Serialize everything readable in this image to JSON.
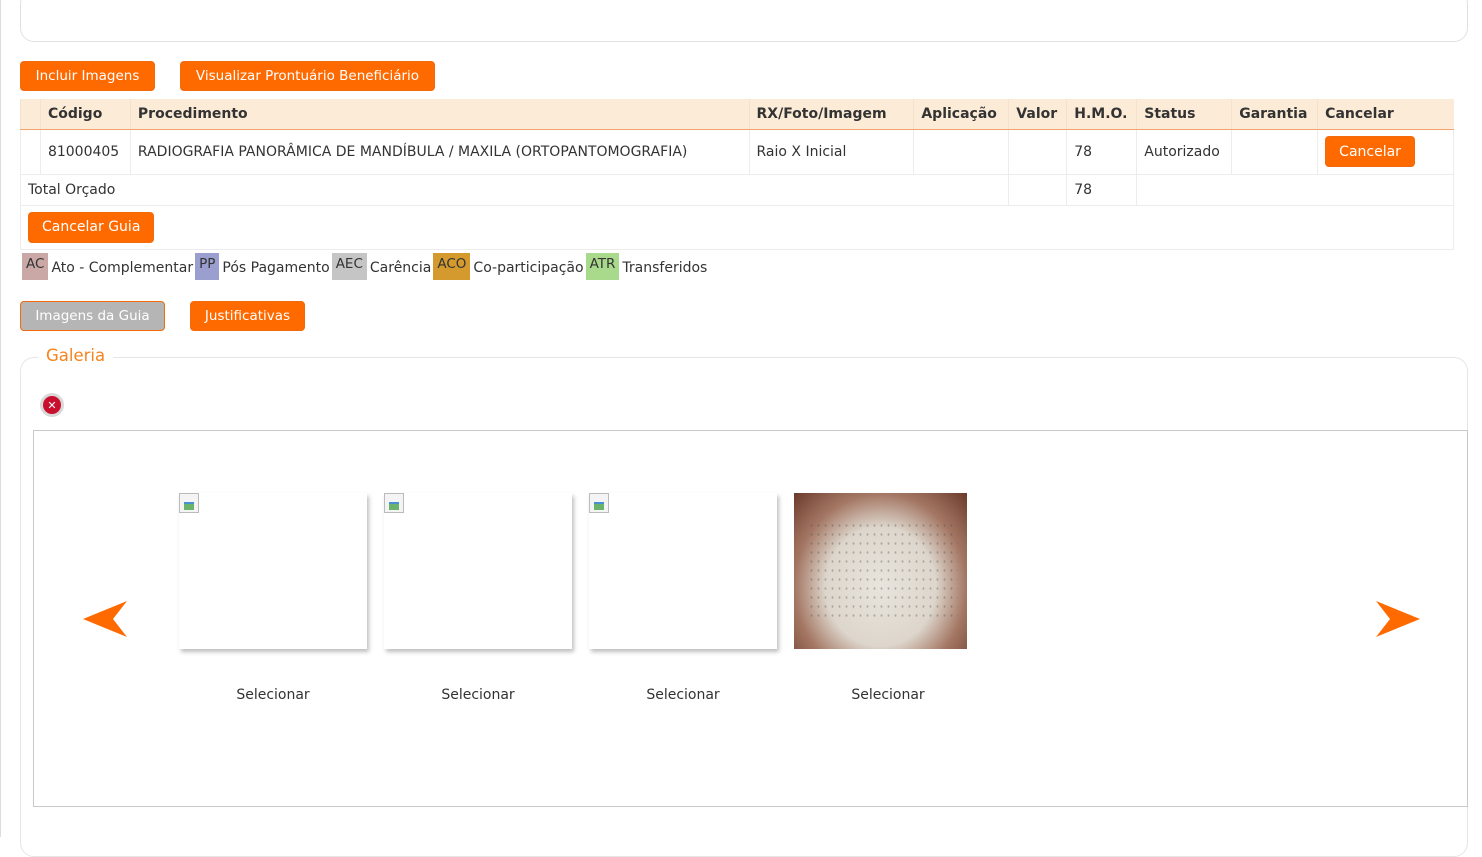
{
  "toolbar": {
    "incluir_imagens": "Incluir Imagens",
    "visualizar_prontuario": "Visualizar Prontuário Beneficiário"
  },
  "table": {
    "headers": [
      "Código",
      "Procedimento",
      "RX/Foto/Imagem",
      "Aplicação",
      "Valor",
      "H.M.O.",
      "Status",
      "Garantia",
      "Cancelar"
    ],
    "rows": [
      {
        "codigo": "81000405",
        "procedimento": "RADIOGRAFIA PANORÂMICA DE MANDÍBULA / MAXILA (ORTOPANTOMOGRAFIA)",
        "rx": "Raio X Inicial",
        "aplicacao": "",
        "valor": "",
        "hmo": "78",
        "status": "Autorizado",
        "garantia": "",
        "cancel_label": "Cancelar"
      }
    ],
    "total_label": "Total Orçado",
    "total_hmo": "78",
    "cancel_guia_label": "Cancelar Guia"
  },
  "legend": [
    {
      "code": "AC",
      "label": "Ato - Complementar",
      "color": "#c9a8a6"
    },
    {
      "code": "PP",
      "label": "Pós Pagamento",
      "color": "#9b9fd0"
    },
    {
      "code": "AEC",
      "label": "Carência",
      "color": "#c5c5c5"
    },
    {
      "code": "ACO",
      "label": "Co-participação",
      "color": "#d49a2e"
    },
    {
      "code": "ATR",
      "label": "Transferidos",
      "color": "#a9d98b"
    }
  ],
  "tabs": {
    "imagens_guia": "Imagens da Guia",
    "justificativas": "Justificativas"
  },
  "gallery": {
    "title": "Galeria",
    "items": [
      {
        "label": "Selecionar"
      },
      {
        "label": "Selecionar"
      },
      {
        "label": "Selecionar"
      },
      {
        "label": "Selecionar"
      }
    ]
  },
  "colors": {
    "accent": "#ff6a00",
    "header_bg": "#fcebd6",
    "gallery_title": "#f5841f"
  },
  "icons": {
    "close": "close-icon",
    "prev": "arrow-left-icon",
    "next": "arrow-right-icon"
  }
}
